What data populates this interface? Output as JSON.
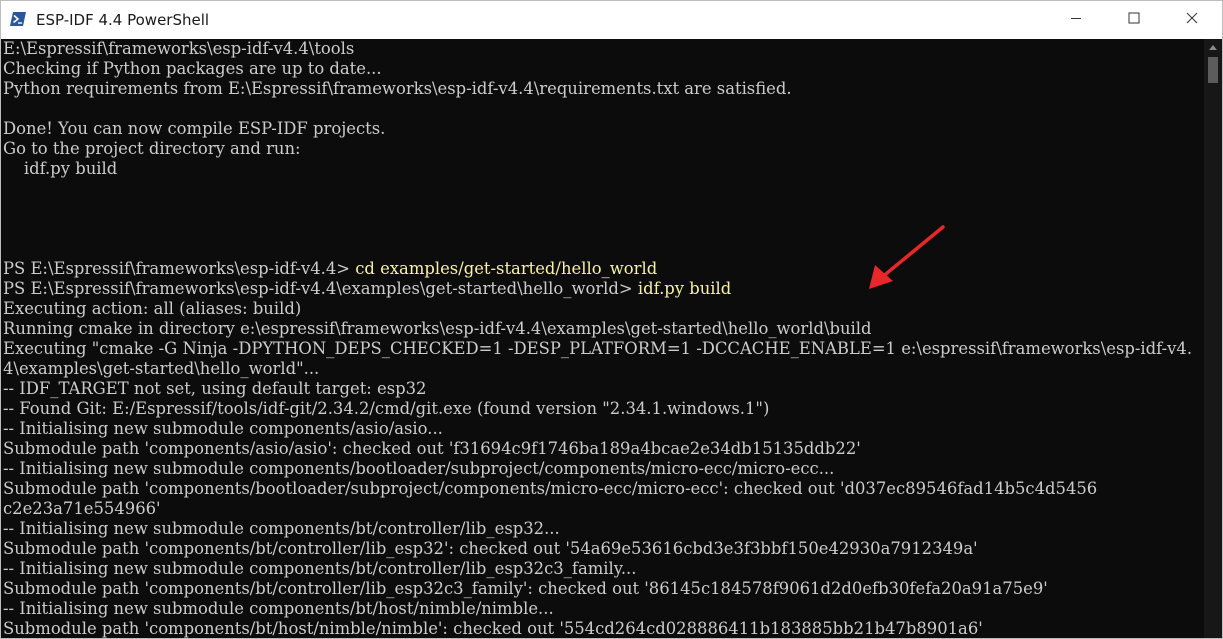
{
  "window": {
    "title": "ESP-IDF 4.4 PowerShell",
    "icon": "powershell-icon",
    "controls": {
      "minimize_icon": "minimize-icon",
      "maximize_icon": "maximize-icon",
      "close_icon": "close-icon"
    }
  },
  "colors": {
    "background": "#0c0c0c",
    "text": "#cccccc",
    "command": "#f9f1a5",
    "arrow": "#e8272b"
  },
  "terminal": {
    "lines": [
      {
        "text": "E:\\Espressif\\frameworks\\esp-idf-v4.4\\tools"
      },
      {
        "text": "Checking if Python packages are up to date..."
      },
      {
        "text": "Python requirements from E:\\Espressif\\frameworks\\esp-idf-v4.4\\requirements.txt are satisfied."
      },
      {
        "text": ""
      },
      {
        "text": "Done! You can now compile ESP-IDF projects."
      },
      {
        "text": "Go to the project directory and run:"
      },
      {
        "text": "    idf.py build"
      },
      {
        "text": ""
      },
      {
        "text": ""
      },
      {
        "text": ""
      },
      {
        "text": ""
      },
      {
        "prompt": "PS E:\\Espressif\\frameworks\\esp-idf-v4.4> ",
        "command": "cd examples/get-started/hello_world"
      },
      {
        "prompt": "PS E:\\Espressif\\frameworks\\esp-idf-v4.4\\examples\\get-started\\hello_world> ",
        "command": "idf.py build"
      },
      {
        "text": "Executing action: all (aliases: build)"
      },
      {
        "text": "Running cmake in directory e:\\espressif\\frameworks\\esp-idf-v4.4\\examples\\get-started\\hello_world\\build"
      },
      {
        "text": "Executing \"cmake -G Ninja -DPYTHON_DEPS_CHECKED=1 -DESP_PLATFORM=1 -DCCACHE_ENABLE=1 e:\\espressif\\frameworks\\esp-idf-v4."
      },
      {
        "text": "4\\examples\\get-started\\hello_world\"..."
      },
      {
        "text": "-- IDF_TARGET not set, using default target: esp32"
      },
      {
        "text": "-- Found Git: E:/Espressif/tools/idf-git/2.34.2/cmd/git.exe (found version \"2.34.1.windows.1\")"
      },
      {
        "text": "-- Initialising new submodule components/asio/asio..."
      },
      {
        "text": "Submodule path 'components/asio/asio': checked out 'f31694c9f1746ba189a4bcae2e34db15135ddb22'"
      },
      {
        "text": "-- Initialising new submodule components/bootloader/subproject/components/micro-ecc/micro-ecc..."
      },
      {
        "text": "Submodule path 'components/bootloader/subproject/components/micro-ecc/micro-ecc': checked out 'd037ec89546fad14b5c4d5456"
      },
      {
        "text": "c2e23a71e554966'"
      },
      {
        "text": "-- Initialising new submodule components/bt/controller/lib_esp32..."
      },
      {
        "text": "Submodule path 'components/bt/controller/lib_esp32': checked out '54a69e53616cbd3e3f3bbf150e42930a7912349a'"
      },
      {
        "text": "-- Initialising new submodule components/bt/controller/lib_esp32c3_family..."
      },
      {
        "text": "Submodule path 'components/bt/controller/lib_esp32c3_family': checked out '86145c184578f9061d2d0efb30fefa20a91a75e9'"
      },
      {
        "text": "-- Initialising new submodule components/bt/host/nimble/nimble..."
      },
      {
        "text": "Submodule path 'components/bt/host/nimble/nimble': checked out '554cd264cd028886411b183885bb21b47b8901a6'"
      }
    ]
  }
}
